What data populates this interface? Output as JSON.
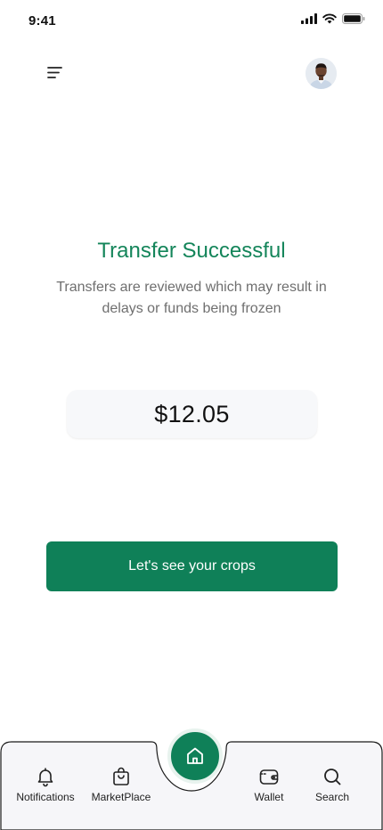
{
  "status_bar": {
    "time": "9:41"
  },
  "header": {
    "menu_icon": "hamburger-menu-icon",
    "avatar_icon": "user-avatar"
  },
  "main": {
    "title": "Transfer Successful",
    "subtitle": "Transfers are reviewed which may result in delays or funds being frozen",
    "amount": "$12.05",
    "cta_label": "Let's see your crops"
  },
  "colors": {
    "brand_green": "#0f8058",
    "title_green": "#14855a",
    "subtitle_gray": "#6f6f6f"
  },
  "bottom_nav": {
    "items": [
      {
        "label": "Notifications",
        "icon": "bell-icon"
      },
      {
        "label": "MarketPlace",
        "icon": "shopping-bag-icon"
      },
      {
        "label": "Wallet",
        "icon": "wallet-icon"
      },
      {
        "label": "Search",
        "icon": "search-icon"
      }
    ],
    "home_icon": "home-icon"
  }
}
